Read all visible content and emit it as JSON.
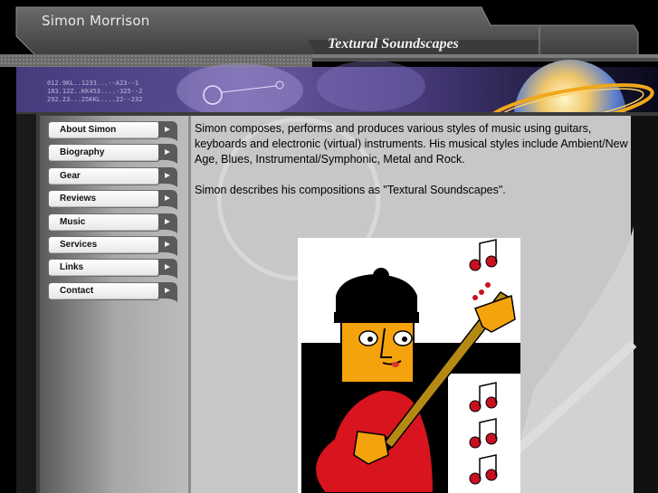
{
  "header": {
    "title": "Simon Morrison",
    "tagline": "Textural Soundscapes",
    "banner_code": "012.9KL..1233...--A23--1\n183.12Z..KK453....-325--2\n292.23...25KKL....22--232"
  },
  "nav": {
    "items": [
      {
        "label": "About Simon",
        "name": "nav-about-simon"
      },
      {
        "label": "Biography",
        "name": "nav-biography"
      },
      {
        "label": "Gear",
        "name": "nav-gear"
      },
      {
        "label": "Reviews",
        "name": "nav-reviews"
      },
      {
        "label": "Music",
        "name": "nav-music"
      },
      {
        "label": "Services",
        "name": "nav-services"
      },
      {
        "label": "Links",
        "name": "nav-links"
      },
      {
        "label": "Contact",
        "name": "nav-contact"
      }
    ],
    "arrow_icon": "chevron-right-icon"
  },
  "content": {
    "paragraph_1": "Simon composes, performs and produces various styles of music using guitars, keyboards and electronic (virtual) instruments. His musical styles include Ambient/New Age, Blues, Instrumental/Symphonic, Metal and Rock.",
    "paragraph_2": "Simon describes his compositions as \"Textural Soundscapes\"."
  },
  "colors": {
    "panel_grey": "#c7c7c7",
    "sidebar_grey": "#a9a9a9",
    "frame_dark": "#4a4a4a",
    "guitar_red": "#d8141e",
    "face_orange": "#f5a30c",
    "neck_olive": "#b58a14"
  }
}
